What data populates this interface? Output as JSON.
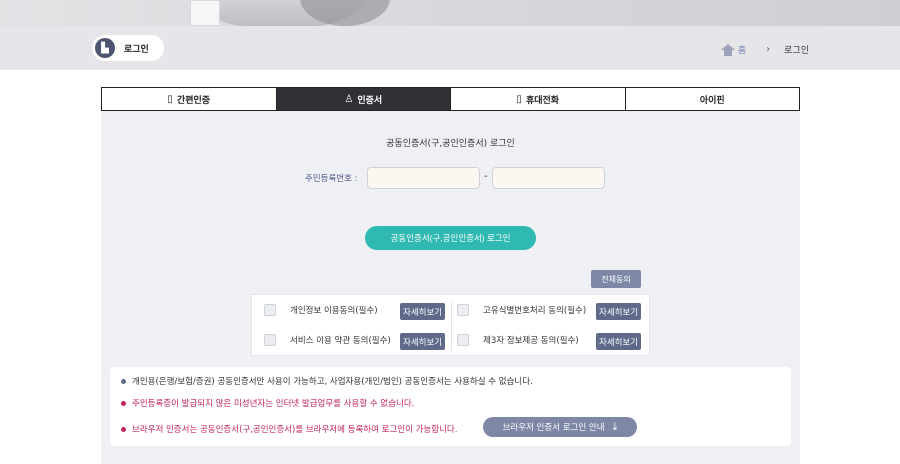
{
  "breadcrumb": {
    "page_pill": "로그인",
    "home": "홈",
    "chevron": "›",
    "current": "로그인"
  },
  "tabs": [
    {
      "label": "간편인증",
      "icon": "phone-icon"
    },
    {
      "label": "인증서",
      "icon": "certificate-icon"
    },
    {
      "label": "휴대전화",
      "icon": "mobile-icon"
    },
    {
      "label": "아이핀",
      "icon": ""
    }
  ],
  "active_tab": "인증서",
  "form": {
    "title": "공동인증서(구,공인인증서) 로그인",
    "id_label": "주민등록번호 :",
    "id_front_value": "",
    "id_back_value": "",
    "separator": "-",
    "login_button": "공동인증서(구,공인인증서) 로그인"
  },
  "agreements": {
    "agree_all": "전체동의",
    "detail_label": "자세히보기",
    "items": [
      {
        "label": "개인정보 이용동의(필수)",
        "checked": false
      },
      {
        "label": "고유식별번호처리 동의(필수)",
        "checked": false
      },
      {
        "label": "서비스 이용 약관 동의(필수)",
        "checked": false
      },
      {
        "label": "제3자 정보제공 동의(필수)",
        "checked": false
      }
    ]
  },
  "notices": [
    {
      "text": "개인용(은행/보험/증권) 공동인증서만 사용이 가능하고, 사업자용(개인/법인) 공동인증서는 사용하실 수 없습니다.",
      "color": "#333333",
      "bullet": "#5f6a8a"
    },
    {
      "text": "주민등록증이 발급되지 않은 미성년자는 인터넷 발급업무를 사용할 수 없습니다.",
      "color": "#c4245a",
      "bullet": "#c4245a"
    },
    {
      "text": "브라우저 인증서는 공동인증서(구,공인인증서)를 브라우저에 등록하여 로그인이 가능합니다.",
      "color": "#c4245a",
      "bullet": "#c4245a"
    }
  ],
  "guide_button": "브라우저 인증서 로그인 안내",
  "colors": {
    "accent": "#2fb9b2",
    "active_tab": "#2f3136",
    "button_gray": "#7e88a6",
    "warning": "#c4245a"
  }
}
